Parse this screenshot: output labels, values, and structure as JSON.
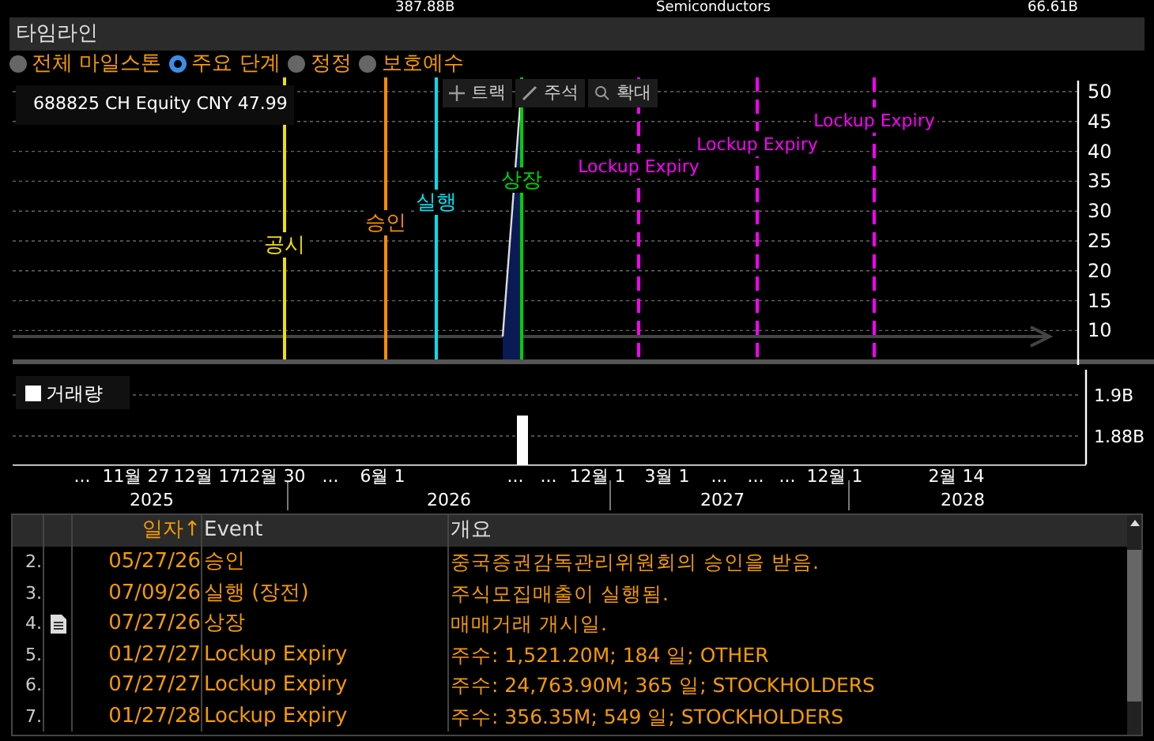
{
  "top_strip": [
    "387.88B",
    "Semiconductors",
    "66.61B"
  ],
  "panel_title": "타임라인",
  "filters": [
    {
      "label": "전체 마일스톤",
      "selected": false
    },
    {
      "label": "주요 단계",
      "selected": true
    },
    {
      "label": "정정",
      "selected": false
    },
    {
      "label": "보호예수",
      "selected": false
    }
  ],
  "legend": {
    "label": "688825 CH Equity CNY 47.99"
  },
  "tools": [
    {
      "label": "트랙",
      "kind": "track"
    },
    {
      "label": "주석",
      "kind": "annotate"
    },
    {
      "label": "확대",
      "kind": "zoom"
    }
  ],
  "events": [
    {
      "label": "공시",
      "kind": "solid",
      "color": "#f0e000"
    },
    {
      "label": "승인",
      "kind": "solid",
      "color": "#ff8c00"
    },
    {
      "label": "실행",
      "kind": "solid",
      "color": "#00e0f0"
    },
    {
      "label": "상장",
      "kind": "solid",
      "color": "#00d000"
    },
    {
      "label": "Lockup Expiry",
      "kind": "dashed",
      "color": "#ff00ff"
    },
    {
      "label": "Lockup Expiry",
      "kind": "dashed",
      "color": "#ff00ff"
    },
    {
      "label": "Lockup Expiry",
      "kind": "dashed",
      "color": "#ff00ff"
    }
  ],
  "price_axis": [
    "50",
    "45",
    "40",
    "35",
    "30",
    "25",
    "20",
    "15",
    "10"
  ],
  "volume": {
    "label": "거래량",
    "ticks": [
      "1.9B",
      "1.88B"
    ]
  },
  "x_axis": {
    "dates": [
      "...",
      "11월 27",
      "12월 17",
      "12월 30",
      "...",
      "6월 1",
      "...",
      "...",
      "12월 1",
      "3월 1",
      "...",
      "...",
      "...",
      "12월 1",
      "2월 14"
    ],
    "years": [
      "2025",
      "2026",
      "2027",
      "2028"
    ]
  },
  "table": {
    "columns": [
      "일자↑",
      "Event",
      "개요"
    ],
    "rows": [
      {
        "num": "2.",
        "note": false,
        "date": "05/27/26",
        "event": "승인",
        "summary": "중국증권감독관리위원회의 승인을 받음."
      },
      {
        "num": "3.",
        "note": false,
        "date": "07/09/26",
        "event": "실행 (장전)",
        "summary": "주식모집매출이 실행됨."
      },
      {
        "num": "4.",
        "note": true,
        "date": "07/27/26",
        "event": "상장",
        "summary": "매매거래 개시일."
      },
      {
        "num": "5.",
        "note": false,
        "date": "01/27/27",
        "event": "Lockup Expiry",
        "summary": "주수: 1,521.20M; 184 일; OTHER"
      },
      {
        "num": "6.",
        "note": false,
        "date": "07/27/27",
        "event": "Lockup Expiry",
        "summary": "주수: 24,763.90M; 365 일; STOCKHOLDERS"
      },
      {
        "num": "7.",
        "note": false,
        "date": "01/27/28",
        "event": "Lockup Expiry",
        "summary": "주수: 356.35M; 549 일; STOCKHOLDERS"
      }
    ]
  }
}
